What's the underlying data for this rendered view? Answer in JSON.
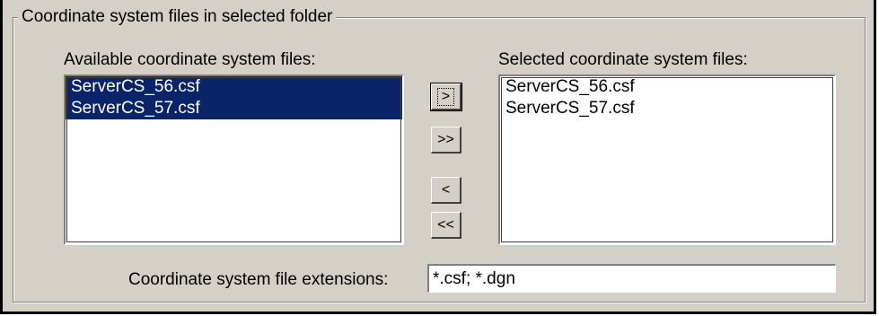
{
  "groupbox": {
    "title": "Coordinate system files in selected folder"
  },
  "available": {
    "label": "Available coordinate system files:",
    "items": [
      {
        "text": "ServerCS_56.csf",
        "selected": true
      },
      {
        "text": "ServerCS_57.csf",
        "selected": true
      }
    ]
  },
  "selected": {
    "label": "Selected coordinate system files:",
    "items": [
      {
        "text": "ServerCS_56.csf"
      },
      {
        "text": "ServerCS_57.csf"
      }
    ]
  },
  "buttons": {
    "add": ">",
    "add_all": ">>",
    "remove": "<",
    "remove_all": "<<"
  },
  "extensions": {
    "label": "Coordinate system file extensions:",
    "value": "*.csf; *.dgn"
  },
  "colors": {
    "selection": "#0a246a",
    "dialog_bg": "#d4d0c8"
  }
}
